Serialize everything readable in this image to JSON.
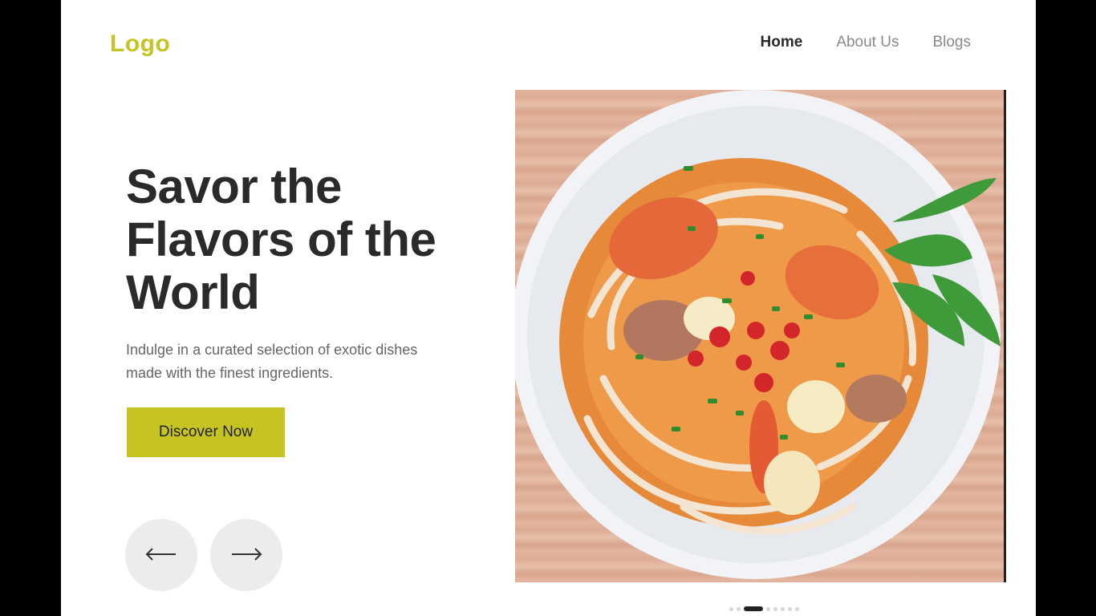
{
  "brand": {
    "logo_text": "Logo",
    "accent_color": "#c5c423"
  },
  "nav": {
    "items": [
      {
        "label": "Home",
        "active": true
      },
      {
        "label": "About Us",
        "active": false
      },
      {
        "label": "Blogs",
        "active": false
      }
    ]
  },
  "hero": {
    "headline_lines": [
      "Savor the",
      "Flavors of the",
      "World"
    ],
    "subtext_lines": [
      "Indulge in a curated selection of exotic dishes",
      "made with the finest ingredients."
    ],
    "cta_label": "Discover Now",
    "prev_icon": "arrow-left-icon",
    "next_icon": "arrow-right-icon",
    "image_subject": "bowl of noodle soup with shrimp, quail eggs and herbs"
  },
  "carousel": {
    "dot_count": 8,
    "active_index": 2
  }
}
